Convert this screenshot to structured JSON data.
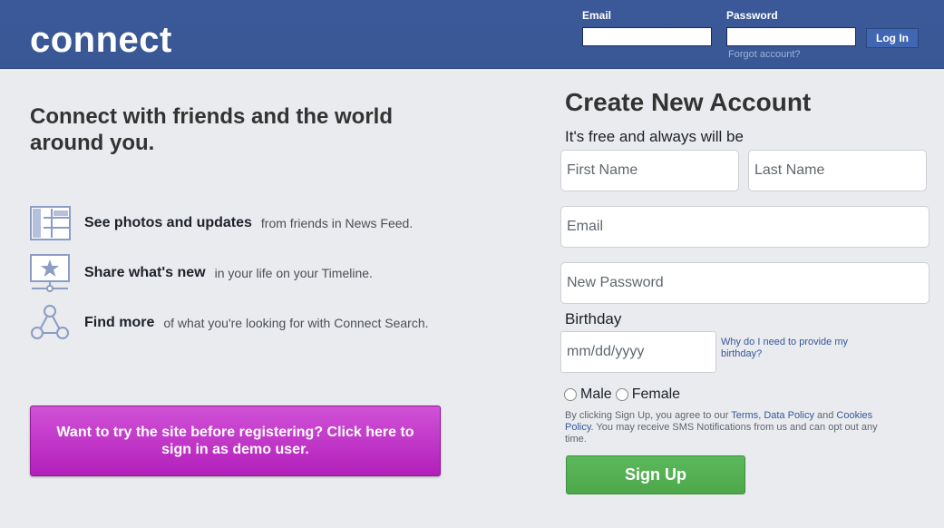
{
  "header": {
    "logo": "connect",
    "email_label": "Email",
    "password_label": "Password",
    "login_button": "Log In",
    "forgot_link": "Forgot account?"
  },
  "left": {
    "tagline": "Connect with friends and the world around you.",
    "features": [
      {
        "icon": "news-feed-icon",
        "strong": "See photos and updates",
        "rest": "from friends in News Feed."
      },
      {
        "icon": "timeline-icon",
        "strong": "Share what's new",
        "rest": "in your life on your Timeline."
      },
      {
        "icon": "search-graph-icon",
        "strong": "Find more",
        "rest": "of what you're looking for with Connect Search."
      }
    ],
    "demo_button": "Want to try the site before registering? Click here to sign in as demo user."
  },
  "register": {
    "title": "Create New Account",
    "subtitle": "It's free and always will be",
    "first_name_placeholder": "First Name",
    "last_name_placeholder": "Last Name",
    "email_placeholder": "Email",
    "password_placeholder": "New Password",
    "birthday_label": "Birthday",
    "birthday_placeholder": "mm/dd/yyyy",
    "birthday_help": "Why do I need to provide my birthday?",
    "gender_male": "Male",
    "gender_female": "Female",
    "terms": {
      "prefix": "By clicking Sign Up, you agree to our ",
      "terms_link": "Terms",
      "sep1": ", ",
      "data_policy_link": "Data Policy",
      "and": " and ",
      "cookies_link": "Cookies Policy",
      "suffix": ". You may receive SMS Notifications from us and can opt out any time."
    },
    "signup_button": "Sign Up"
  },
  "colors": {
    "header": "#3b5998",
    "demo_button": "#c23ac9",
    "signup_button": "#53b051",
    "background": "#e9ebee"
  }
}
